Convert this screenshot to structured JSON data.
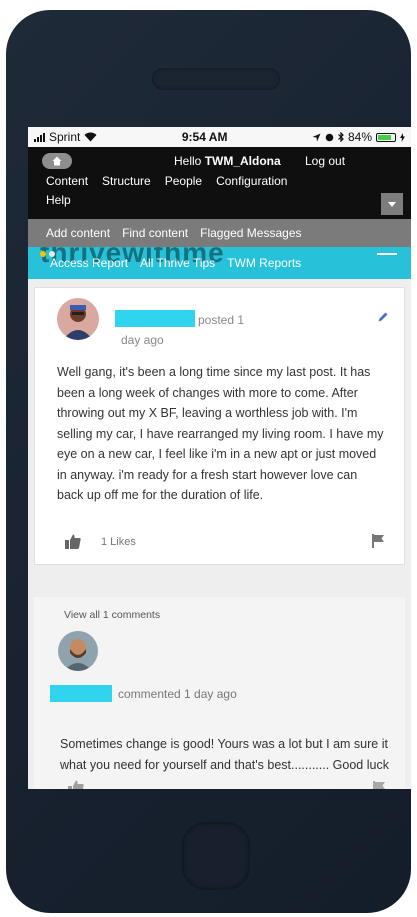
{
  "status_bar": {
    "carrier": "Sprint",
    "time": "9:54 AM",
    "battery": "84%",
    "battery_level": 84
  },
  "admin_toolbar": {
    "hello_prefix": "Hello ",
    "username": "TWM_Aldona",
    "logout": "Log out",
    "menu": [
      "Content",
      "Structure",
      "People",
      "Configuration"
    ],
    "help": "Help"
  },
  "shortcuts": [
    "Add content",
    "Find content",
    "Flagged Messages"
  ],
  "site_nav": {
    "logo_text": "thrivewithme",
    "links": [
      "Access Report",
      "All Thrive Tips",
      "TWM Reports"
    ]
  },
  "post": {
    "posted_label": "posted 1",
    "posted_label_2": "day ago",
    "body": "Well gang, it's been a long time since my last post. It has been a long week of changes with more to come. After throwing out my X BF, leaving a worthless job with. I'm selling my car, I have rearranged my living room. I have my eye on a new car, I feel like i'm in a new apt or just moved in anyway. i'm ready for a fresh start however love can back up off me for the duration of life.",
    "likes": "1 Likes"
  },
  "comments": {
    "view_all": "View all 1 comments",
    "commented_label": "commented  1 day ago",
    "body": "Sometimes change is good! Yours was a lot but I am sure it what you need for yourself and that's best........... Good luck"
  },
  "colors": {
    "site_bar": "#27c1d9",
    "redaction": "#31d4ef",
    "admin_bar": "#0f0f0f",
    "shortcut_bar": "#7b7b7b",
    "phone_body": "#1c2634"
  },
  "icons": [
    "wifi-icon",
    "home-icon",
    "chevron-down-icon",
    "pencil-icon",
    "thumbs-up-icon",
    "flag-icon",
    "hamburger-icon"
  ]
}
